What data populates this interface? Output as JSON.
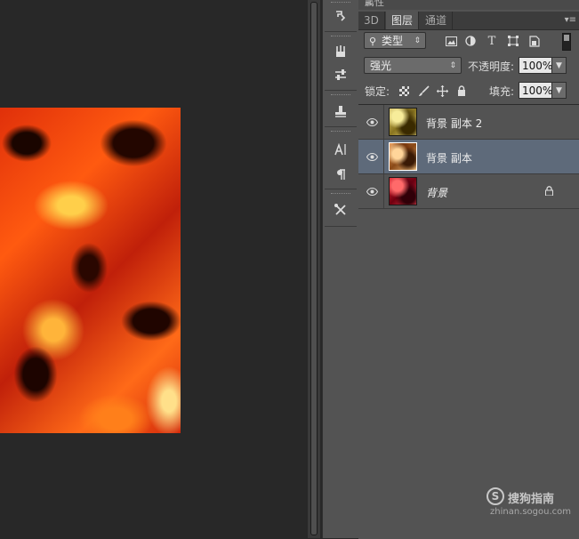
{
  "panel": {
    "properties_title": "属性",
    "tabs": [
      {
        "label": "3D"
      },
      {
        "label": "图层"
      },
      {
        "label": "通道"
      }
    ],
    "filter": {
      "kind_value": "类型",
      "icons": [
        "image-filter-icon",
        "adjustment-filter-icon",
        "type-filter-icon",
        "shape-filter-icon",
        "smart-object-filter-icon"
      ]
    },
    "blend": {
      "mode_value": "强光",
      "opacity_label": "不透明度:",
      "opacity_value": "100%"
    },
    "lock": {
      "label": "锁定:",
      "fill_label": "填充:",
      "fill_value": "100%"
    },
    "layers": [
      {
        "name": "背景 副本 2",
        "visible": true,
        "selected": false,
        "locked": false
      },
      {
        "name": "背景 副本",
        "visible": true,
        "selected": true,
        "locked": false
      },
      {
        "name": "背景",
        "visible": true,
        "selected": false,
        "locked": true
      }
    ]
  },
  "watermark": {
    "name": "搜狗指南",
    "url": "zhinan.sogou.com"
  },
  "colors": {
    "selected_layer": "#5e6a7a",
    "panel_bg": "#535353",
    "canvas_bg": "#282828"
  }
}
